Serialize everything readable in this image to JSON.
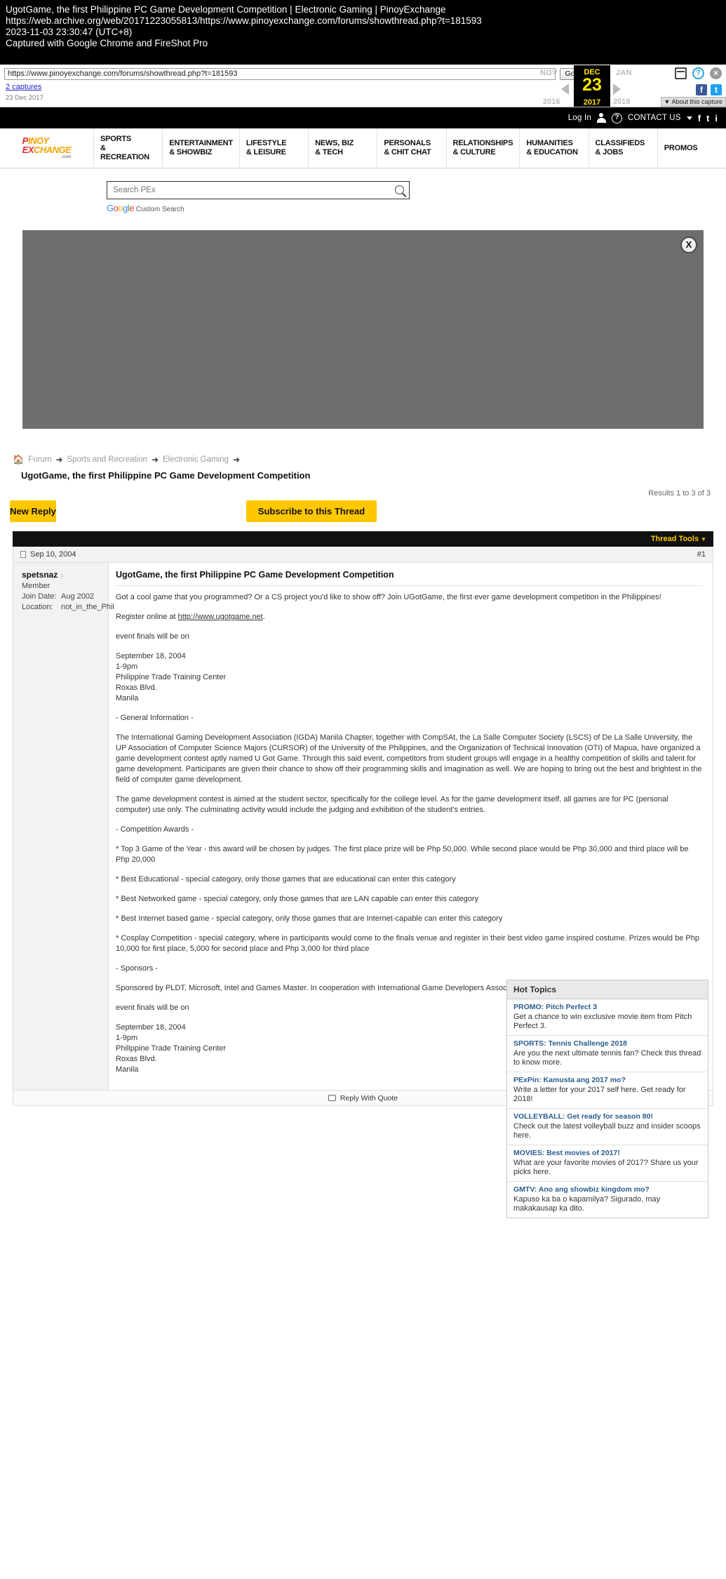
{
  "fireshot": {
    "title": "UgotGame, the first Philippine PC Game Development Competition | Electronic Gaming | PinoyExchange",
    "url": "https://web.archive.org/web/20171223055813/https://www.pinoyexchange.com/forums/showthread.php?t=181593",
    "timestamp": "2023-11-03 23:30:47 (UTC+8)",
    "captured_with": "Captured with Google Chrome and FireShot Pro"
  },
  "wayback": {
    "url_value": "https://www.pinoyexchange.com/forums/showthread.php?t=181593",
    "go_label": "Go",
    "captures_link": "2 captures",
    "capture_date": "23 Dec 2017",
    "month_prev": "NOV",
    "month_current": "DEC",
    "month_next": "JAN",
    "day": "23",
    "year_prev": "2016",
    "year_current": "2017",
    "year_next": "2018",
    "about_label": "About this capture",
    "accent_yellow": "#ffe600"
  },
  "topbar": {
    "login": "Log In",
    "contact": "CONTACT US",
    "facebook": "f",
    "twitter": "t",
    "instagram": "i"
  },
  "logo": {
    "line1_a": "P",
    "line1_b": "INOY",
    "line2_a": "EX",
    "line2_b": "CHANGE",
    "suffix": ".com"
  },
  "nav": {
    "items": [
      {
        "l1": "SPORTS",
        "l2": "& RECREATION"
      },
      {
        "l1": "ENTERTAINMENT",
        "l2": "& SHOWBIZ"
      },
      {
        "l1": "LIFESTYLE",
        "l2": "& LEISURE"
      },
      {
        "l1": "NEWS, BIZ",
        "l2": "& TECH"
      },
      {
        "l1": "PERSONALS",
        "l2": "& CHIT CHAT"
      },
      {
        "l1": "RELATIONSHIPS",
        "l2": "& CULTURE"
      },
      {
        "l1": "HUMANITIES",
        "l2": "& EDUCATION"
      },
      {
        "l1": "CLASSIFIEDS",
        "l2": "& JOBS"
      }
    ],
    "promos": "PROMOS"
  },
  "search": {
    "placeholder": "Search PEx",
    "value": "",
    "provider_suffix": "Custom Search",
    "provider_letters": [
      "G",
      "o",
      "o",
      "g",
      "l",
      "e"
    ]
  },
  "ad": {
    "close_label": "X"
  },
  "breadcrumb": {
    "items": [
      "Forum",
      "Sports and Recreation",
      "Electronic Gaming"
    ],
    "arrow": "➜",
    "thread_title": "UgotGame, the first Philippine PC Game Development Competition"
  },
  "thread": {
    "results": "Results 1 to 3 of 3",
    "new_reply": "New Reply",
    "subscribe": "Subscribe to this Thread",
    "thread_tools": "Thread Tools"
  },
  "post": {
    "date": "Sep 10, 2004",
    "number": "#1",
    "username": "spetsnaz",
    "usertitle": "Member",
    "join_label": "Join Date:",
    "join_value": "Aug 2002",
    "location_label": "Location:",
    "location_value": "not_in_the_Phil",
    "title": "UgotGame, the first Philippine PC Game Development Competition",
    "paragraphs": [
      "Got a cool game that you programmed? Or a CS project you'd like to show off? Join UGotGame, the first ever game development competition in the Philippines!",
      "Register online at http://www.ugotgame.net.",
      "event finals will be on",
      "September 18, 2004\n1-9pm\nPhilippine Trade Training Center\nRoxas Blvd.\nManila",
      "- General Information -",
      "The International Gaming Development Association (IGDA) Manila Chapter, together with CompSAt, the La Salle Computer Society (LSCS) of De La Salle University, the UP Association of Computer Science Majors (CURSOR) of the University of the Philippines, and the Organization of Technical Innovation (OTI) of Mapua, have organized a game development contest aptly named U Got Game. Through this said event, competitors from student groups will engage in a healthy competition of skills and talent for game development. Participants are given their chance to show off their programming skills and imagination as well. We are hoping to bring out the best and brightest in the field of computer game development.",
      "The game development contest is aimed at the student sector, specifically for the college level. As for the game development itself, all games are for PC (personal computer) use only. The culminating activity would include the judging and exhibition of the student's entries.",
      "- Competition Awards -",
      "* Top 3 Game of the Year - this award will be chosen by judges. The first place prize will be Php 50,000. While second place would be Php 30,000 and third place will be Php 20,000",
      "* Best Educational - special category, only those games that are educational can enter this category",
      "* Best Networked game - special category, only those games that are LAN capable can enter this category",
      "* Best Internet based game - special category, only those games that are Internet-capable can enter this category",
      "* Cosplay Competition - special category, where in participants would come to the finals venue and register in their best video game inspired costume. Prizes would be Php 10,000 for first place, 5,000 for second place and Php 3,000 for third place",
      "- Sponsors -",
      "Sponsored by PLDT, Microsoft, Intel and Games Master. In cooperation with International Game Developers Association, Manila Chapter",
      "event finals will be on",
      "September 18, 2004\n1-9pm\nPhilippine Trade Training Center\nRoxas Blvd.\nManila"
    ],
    "register_link_text": "http://www.ugotgame.net",
    "reply_with_quote": "Reply With Quote"
  },
  "hot_topics": {
    "heading": "Hot Topics",
    "items": [
      {
        "title": "PROMO: Pitch Perfect 3",
        "desc": "Get a chance to win exclusive movie item from Pitch Perfect 3."
      },
      {
        "title": "SPORTS: Tennis Challenge 2018",
        "desc": "Are you the next ultimate tennis fan? Check this thread to know more."
      },
      {
        "title": "PExPin: Kamusta ang 2017 mo?",
        "desc": "Write a letter for your 2017 self here. Get ready for 2018!"
      },
      {
        "title": "VOLLEYBALL: Get ready for season 80!",
        "desc": "Check out the latest volleyball buzz and insider scoops here."
      },
      {
        "title": "MOVIES: Best movies of 2017!",
        "desc": "What are your favorite movies of 2017? Share us your picks here."
      },
      {
        "title": "GMTV: Ano ang showbiz kingdom mo?",
        "desc": "Kapuso ka ba o kapamilya? Sigurado, may makakausap ka dito."
      }
    ]
  }
}
